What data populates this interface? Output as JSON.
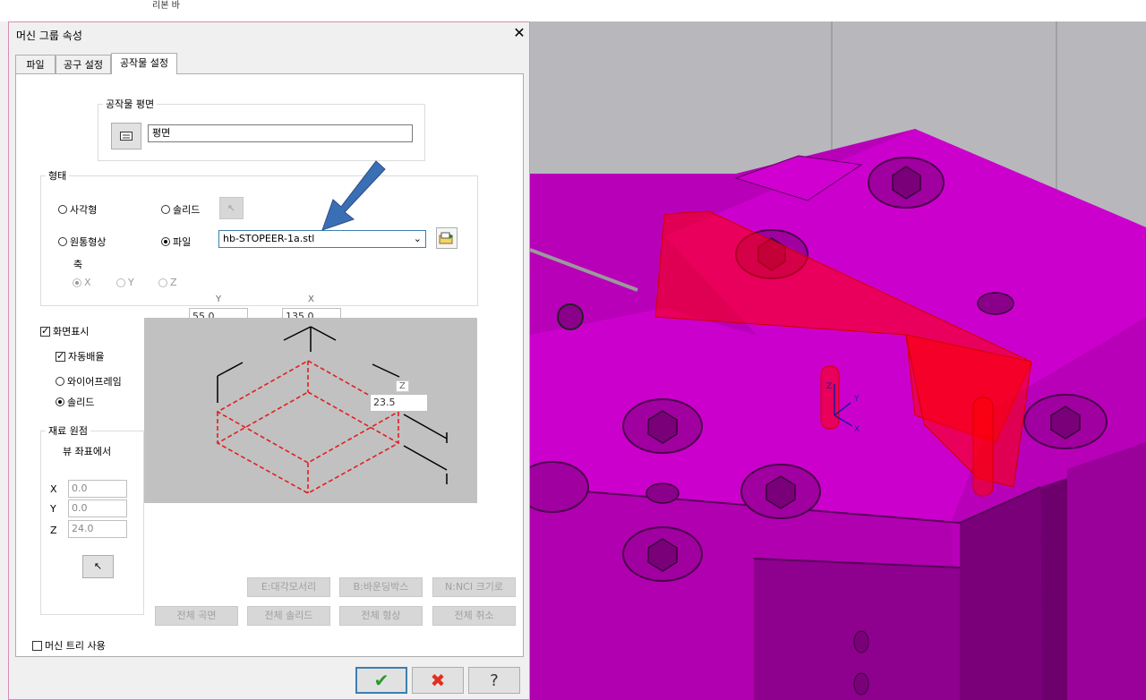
{
  "app": {
    "ribbon_label": "리본 바"
  },
  "dialog": {
    "title": "머신 그룹 속성",
    "tabs": [
      {
        "label": "파일",
        "active": false
      },
      {
        "label": "공구 설정",
        "active": false
      },
      {
        "label": "공작물 설정",
        "active": true
      }
    ],
    "plane_group": {
      "legend": "공작물 평면",
      "value": "평면",
      "button_icon": "plane-list-icon"
    },
    "shape_group": {
      "legend": "형태",
      "options": [
        {
          "label": "사각형",
          "selected": false
        },
        {
          "label": "솔리드",
          "selected": false
        },
        {
          "label": "원통형상",
          "selected": false
        },
        {
          "label": "파일",
          "selected": true
        }
      ],
      "file_value": "hb-STOPEER-1a.stl",
      "axis_label": "축",
      "axis_options": [
        {
          "label": "X",
          "selected": true
        },
        {
          "label": "Y",
          "selected": false
        },
        {
          "label": "Z",
          "selected": false
        }
      ]
    },
    "display": {
      "show_label": "화면표시",
      "show_checked": true,
      "auto_label": "자동배율",
      "auto_checked": true,
      "wireframe_label": "와이어프레임",
      "wireframe_selected": false,
      "solid_label": "솔리드",
      "solid_selected": true
    },
    "preview": {
      "y_axis": "Y",
      "x_axis": "X",
      "z_axis": "Z",
      "y_value": "55.0",
      "x_value": "135.0",
      "z_value": "23.5"
    },
    "origin": {
      "legend": "재료 원점",
      "subtitle": "뷰 좌표에서",
      "x_label": "X",
      "x_value": "0.0",
      "y_label": "Y",
      "y_value": "0.0",
      "z_label": "Z",
      "z_value": "24.0"
    },
    "buttons_row1": [
      "E:대각모서리",
      "B:바운딩박스",
      "N:NCI 크기로"
    ],
    "buttons_row2": [
      "전체 곡면",
      "전체 솔리드",
      "전체 형상",
      "전체 취소"
    ],
    "machine_tree_label": "머신 트리 사용",
    "machine_tree_checked": false,
    "ok_icon": "check-icon",
    "cancel_icon": "x-icon",
    "help_icon": "help-icon"
  },
  "colors": {
    "part": "#cc00cc",
    "stock": "#ff0000",
    "arrow": "#3b6fb5",
    "dialog_border": "#d98cb3"
  }
}
